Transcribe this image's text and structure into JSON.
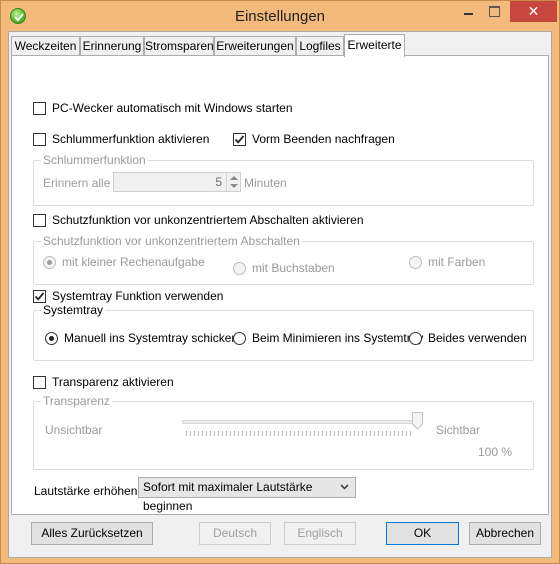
{
  "window": {
    "title": "Einstellungen",
    "close_glyph": "✕"
  },
  "tabs": [
    {
      "label": "Weckzeiten"
    },
    {
      "label": "Erinnerung"
    },
    {
      "label": "Stromsparen"
    },
    {
      "label": "Erweiterungen"
    },
    {
      "label": "Logfiles"
    },
    {
      "label": "Erweiterte",
      "active": true
    }
  ],
  "autostart": {
    "label": "PC-Wecker automatisch mit Windows starten",
    "checked": false
  },
  "snooze": {
    "label": "Schlummerfunktion aktivieren",
    "checked": false
  },
  "confirm_exit": {
    "label": "Vorm Beenden nachfragen",
    "checked": true
  },
  "snooze_group": {
    "title": "Schlummerfunktion",
    "remind_label": "Erinnern alle",
    "value": "5",
    "unit": "Minuten"
  },
  "protect": {
    "label": "Schutzfunktion vor unkonzentriertem Abschalten aktivieren",
    "checked": false
  },
  "protect_group": {
    "title": "Schutzfunktion vor unkonzentriertem Abschalten",
    "options": [
      {
        "label": "mit kleiner Rechenaufgabe",
        "selected": true
      },
      {
        "label": "mit Buchstaben",
        "selected": false
      },
      {
        "label": "mit Farben",
        "selected": false
      }
    ]
  },
  "tray": {
    "label": "Systemtray Funktion verwenden",
    "checked": true
  },
  "tray_group": {
    "title": "Systemtray",
    "options": [
      {
        "label": "Manuell ins Systemtray schicken",
        "selected": true
      },
      {
        "label": "Beim Minimieren ins Systemtray",
        "selected": false
      },
      {
        "label": "Beides verwenden",
        "selected": false
      }
    ]
  },
  "transparency": {
    "label": "Transparenz aktivieren",
    "checked": false
  },
  "transparency_group": {
    "title": "Transparenz",
    "min_label": "Unsichtbar",
    "max_label": "Sichtbar",
    "value_label": "100 %",
    "level": 1.0
  },
  "volume": {
    "label": "Lautstärke erhöhen",
    "selected": "Sofort mit maximaler Lautstärke beginnen"
  },
  "buttons": {
    "reset": "Alles Zurücksetzen",
    "german": "Deutsch",
    "english": "Englisch",
    "ok": "OK",
    "cancel": "Abbrechen"
  },
  "colors": {
    "accent": "#0078d7",
    "titlebar": "#f3ba7b",
    "close": "#c7463d"
  }
}
